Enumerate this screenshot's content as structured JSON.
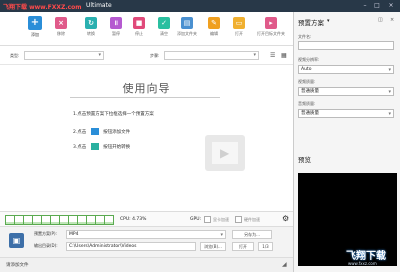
{
  "titlebar": {
    "watermark": "飞翔下载 www.FXXZ.com",
    "title": "Ultimate"
  },
  "toolbar": {
    "add": "添加",
    "remove": "移除",
    "convert": "转换",
    "pause": "暂停",
    "stop": "停止",
    "clear": "清空",
    "add_folder": "添加文件夹",
    "edit": "编辑",
    "open": "打开",
    "open_dest": "打开目标文件夹"
  },
  "filter": {
    "label1": "类型:",
    "label2": "步骤:"
  },
  "guide": {
    "title": "使用向导",
    "step1": "1.点击预置方案下拉框选择一个预置方案",
    "step2_prefix": "2.点击",
    "step2_action": "按钮添加文件",
    "step3_prefix": "3.点击",
    "step3_action": "按钮开始转换"
  },
  "cpu": {
    "text": "CPU: 4.73%",
    "gpu_label": "GPU:",
    "gpu_opt1": "显卡加速",
    "gpu_opt2": "硬件加速",
    "level": 0.2
  },
  "output": {
    "preset_label": "预置方案(P):",
    "preset_value": "MP4",
    "dir_label": "输出目录(D):",
    "dir_value": "C:\\Users\\Administrator\\Videos",
    "save_as": "另存为...",
    "browse": "浏览(B)...",
    "open": "打开",
    "count": "1/3"
  },
  "statusbar": {
    "text": "请添加文件"
  },
  "right": {
    "preset_title": "预置方案",
    "file_name_label": "文件名:",
    "video_res_label": "视频分辨率:",
    "video_res_value": "Auto",
    "video_q_label": "视频质量:",
    "video_q_value": "普通质量",
    "audio_q_label": "音频质量:",
    "audio_q_value": "普通质量",
    "preview_title": "预览"
  },
  "watermark2": {
    "text": "飞翔下载",
    "url": "www.fxxz.com"
  }
}
